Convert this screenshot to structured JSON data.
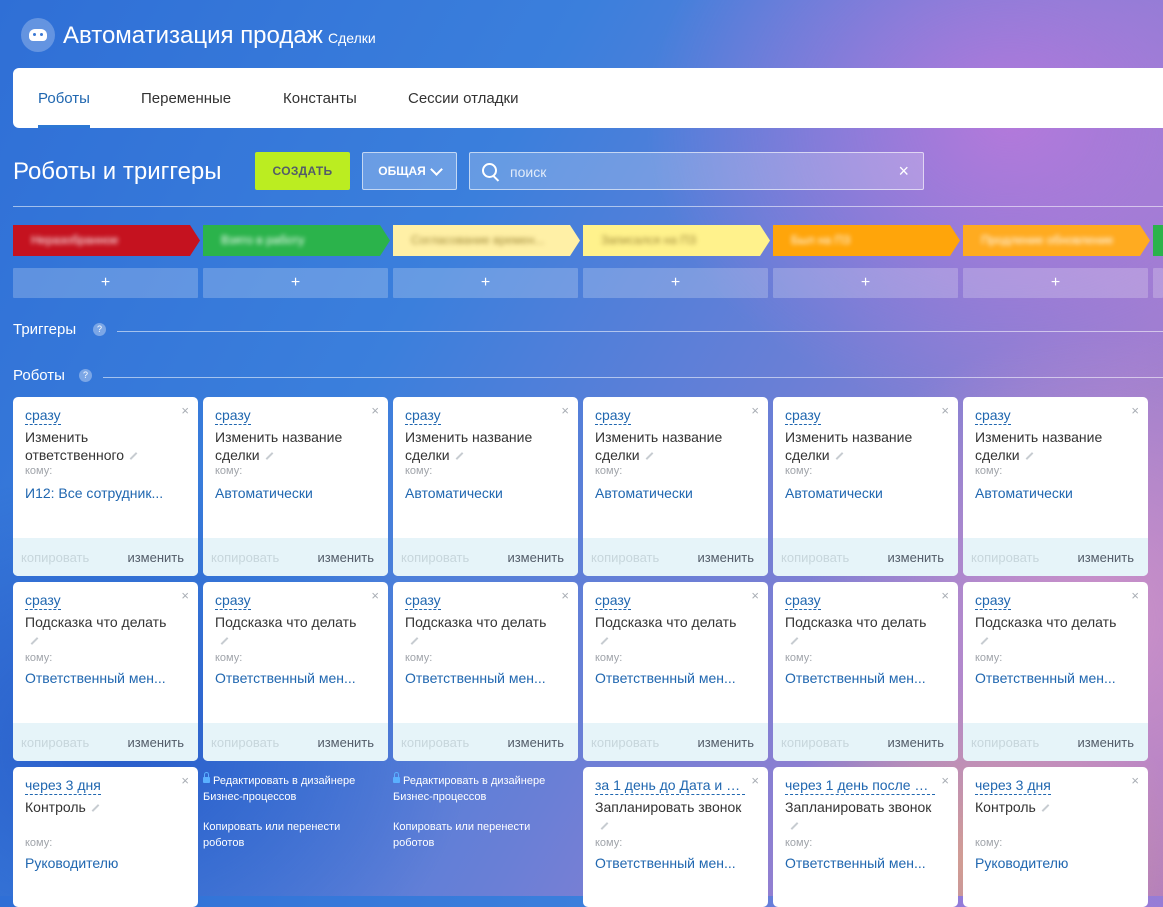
{
  "header": {
    "title": "Автоматизация продаж",
    "subtitle": "Сделки"
  },
  "tabs": [
    {
      "label": "Роботы",
      "active": true
    },
    {
      "label": "Переменные",
      "active": false
    },
    {
      "label": "Константы",
      "active": false
    },
    {
      "label": "Сессии отладки",
      "active": false
    }
  ],
  "toolbar": {
    "title": "Роботы и триггеры",
    "create_label": "СОЗДАТЬ",
    "general_label": "ОБЩАЯ",
    "search_placeholder": "поиск"
  },
  "stages": [
    {
      "label": "Неразобранное",
      "color": "#c5121f"
    },
    {
      "label": "Взято в работу",
      "color": "#2bb34b"
    },
    {
      "label": "Согласование времен...",
      "color": "#fff0a6"
    },
    {
      "label": "Записался на ПЗ",
      "color": "#fff28c"
    },
    {
      "label": "Был на ПЗ",
      "color": "#ffa50a"
    },
    {
      "label": "Продление обновление",
      "color": "#ffab20"
    }
  ],
  "add_label": "+",
  "sections": {
    "triggers": "Триггеры",
    "robots": "Роботы",
    "help": "?"
  },
  "card_labels": {
    "to": "кому:",
    "copy": "копировать",
    "edit": "изменить",
    "close": "×"
  },
  "designer": {
    "edit": "Редактировать в дизайнере Бизнес-процессов",
    "copy": "Копировать или перенести роботов"
  },
  "robots": {
    "row1": [
      {
        "delay": "сразу",
        "title": "Изменить ответственного",
        "to": "И12: Все сотрудник..."
      },
      {
        "delay": "сразу",
        "title": "Изменить название сделки",
        "to": "Автоматически"
      },
      {
        "delay": "сразу",
        "title": "Изменить название сделки",
        "to": "Автоматически"
      },
      {
        "delay": "сразу",
        "title": "Изменить название сделки",
        "to": "Автоматически"
      },
      {
        "delay": "сразу",
        "title": "Изменить название сделки",
        "to": "Автоматически"
      },
      {
        "delay": "сразу",
        "title": "Изменить название сделки",
        "to": "Автоматически"
      }
    ],
    "row2": [
      {
        "delay": "сразу",
        "title": "Подсказка что делать",
        "to": "Ответственный мен..."
      },
      {
        "delay": "сразу",
        "title": "Подсказка что делать",
        "to": "Ответственный мен..."
      },
      {
        "delay": "сразу",
        "title": "Подсказка что делать",
        "to": "Ответственный мен..."
      },
      {
        "delay": "сразу",
        "title": "Подсказка что делать",
        "to": "Ответственный мен..."
      },
      {
        "delay": "сразу",
        "title": "Подсказка что делать",
        "to": "Ответственный мен..."
      },
      {
        "delay": "сразу",
        "title": "Подсказка что делать",
        "to": "Ответственный мен..."
      }
    ],
    "row3": [
      {
        "delay": "через 3 дня",
        "title": "Контроль",
        "to": "Руководителю"
      },
      null,
      null,
      {
        "delay": "за 1 день до Дата и вр...",
        "title": "Запланировать звонок",
        "to": "Ответственный мен..."
      },
      {
        "delay": "через 1 день после Да...",
        "title": "Запланировать звонок",
        "to": "Ответственный мен..."
      },
      {
        "delay": "через 3 дня",
        "title": "Контроль",
        "to": "Руководителю"
      }
    ]
  }
}
